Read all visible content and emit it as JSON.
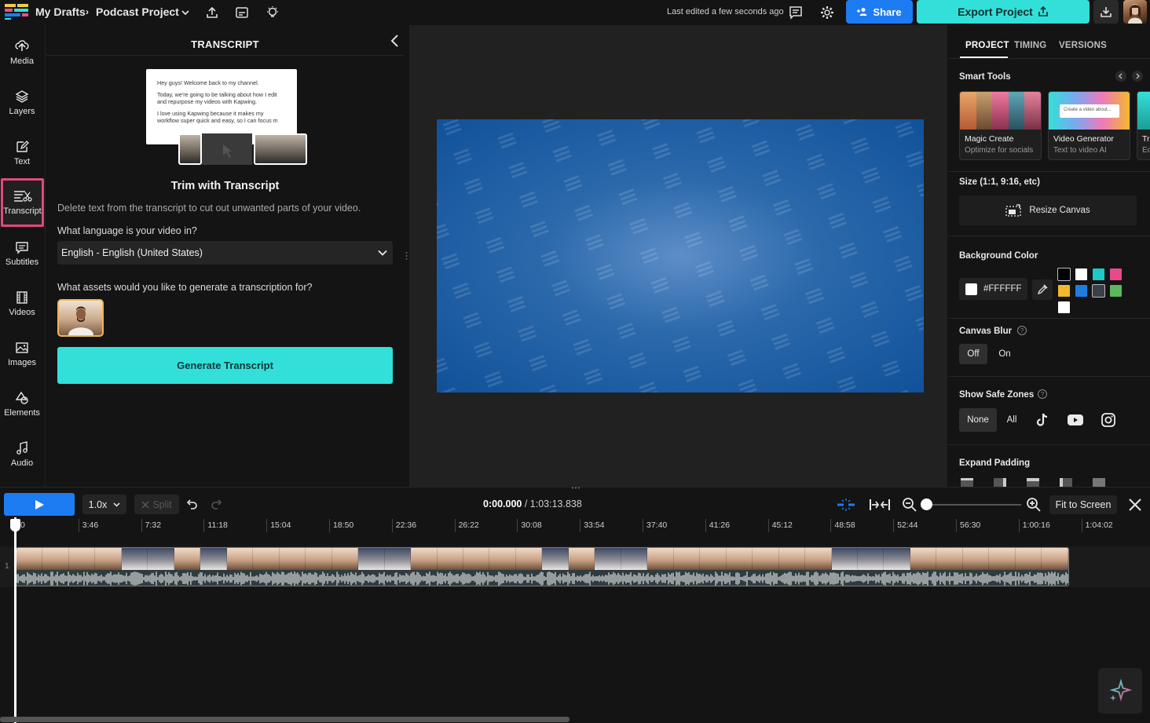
{
  "topbar": {
    "breadcrumb_root": "My Drafts",
    "breadcrumb_sep": "›",
    "project_name": "Podcast Project",
    "last_edited": "Last edited a few seconds ago",
    "share_label": "Share",
    "export_label": "Export Project"
  },
  "leftnav": {
    "items": [
      {
        "label": "Media",
        "icon": "upload-icon"
      },
      {
        "label": "Layers",
        "icon": "layers-icon"
      },
      {
        "label": "Text",
        "icon": "text-edit-icon"
      },
      {
        "label": "Transcript",
        "icon": "transcript-icon",
        "active": true
      },
      {
        "label": "Subtitles",
        "icon": "subtitles-icon"
      },
      {
        "label": "Videos",
        "icon": "film-icon"
      },
      {
        "label": "Images",
        "icon": "image-icon"
      },
      {
        "label": "Elements",
        "icon": "shapes-icon"
      },
      {
        "label": "Audio",
        "icon": "music-note-icon"
      }
    ]
  },
  "transcript_panel": {
    "title": "TRANSCRIPT",
    "illustration_lines": [
      "Hey guys! Welcome back to my channel.",
      "Today, we're going to be talking about how I edit and repurpose my videos with Kapwing.",
      "I love using Kapwing because it makes my workflow super quick and easy, so I can focus m"
    ],
    "heading": "Trim with Transcript",
    "description": "Delete text from the transcript to cut out unwanted parts of your video.",
    "language_question": "What language is your video in?",
    "language_value": "English - English (United States)",
    "assets_question": "What assets would you like to generate a transcription for?",
    "generate_label": "Generate Transcript"
  },
  "right_panel": {
    "tabs": [
      "PROJECT",
      "TIMING",
      "VERSIONS"
    ],
    "active_tab": "PROJECT",
    "smart_tools_label": "Smart Tools",
    "smart_tools": [
      {
        "title": "Magic Create",
        "subtitle": "Optimize for socials"
      },
      {
        "title": "Video Generator",
        "subtitle": "Text to video AI",
        "preview_text": "Create a video about..."
      },
      {
        "title": "Tr",
        "subtitle": "Ec"
      }
    ],
    "size_label": "Size (1:1, 9:16, etc)",
    "resize_label": "Resize Canvas",
    "bg_color_label": "Background Color",
    "bg_color_value": "#FFFFFF",
    "swatches": [
      "#000000",
      "#ffffff",
      "#1ec8c8",
      "#e84a88",
      "#f2b82e",
      "#1e7ee0",
      "#3a3f48",
      "#5cb85c",
      "#ffffff"
    ],
    "canvas_blur_label": "Canvas Blur",
    "blur_off": "Off",
    "blur_on": "On",
    "safe_zones_label": "Show Safe Zones",
    "safe_none": "None",
    "safe_all": "All",
    "safe_zone_icons": [
      "tiktok-icon",
      "youtube-icon",
      "instagram-icon"
    ],
    "expand_padding_label": "Expand Padding"
  },
  "canvas": {
    "background_color": "#10519a"
  },
  "timeline": {
    "speed": "1.0x",
    "split_label": "Split",
    "current_time": "0:00.000",
    "total_time": "/ 1:03:13.838",
    "fit_label": "Fit to Screen",
    "track_number": "1",
    "ruler_ticks": [
      "0",
      "3:46",
      "7:32",
      "11:18",
      "15:04",
      "18:50",
      "22:36",
      "26:22",
      "30:08",
      "33:54",
      "37:40",
      "41:26",
      "45:12",
      "48:58",
      "52:44",
      "56:30",
      "1:00:16",
      "1:04:02"
    ]
  },
  "colors": {
    "accent_blue": "#1e7cf2",
    "accent_teal": "#33e0d9",
    "active_nav_border": "#e2487f"
  }
}
